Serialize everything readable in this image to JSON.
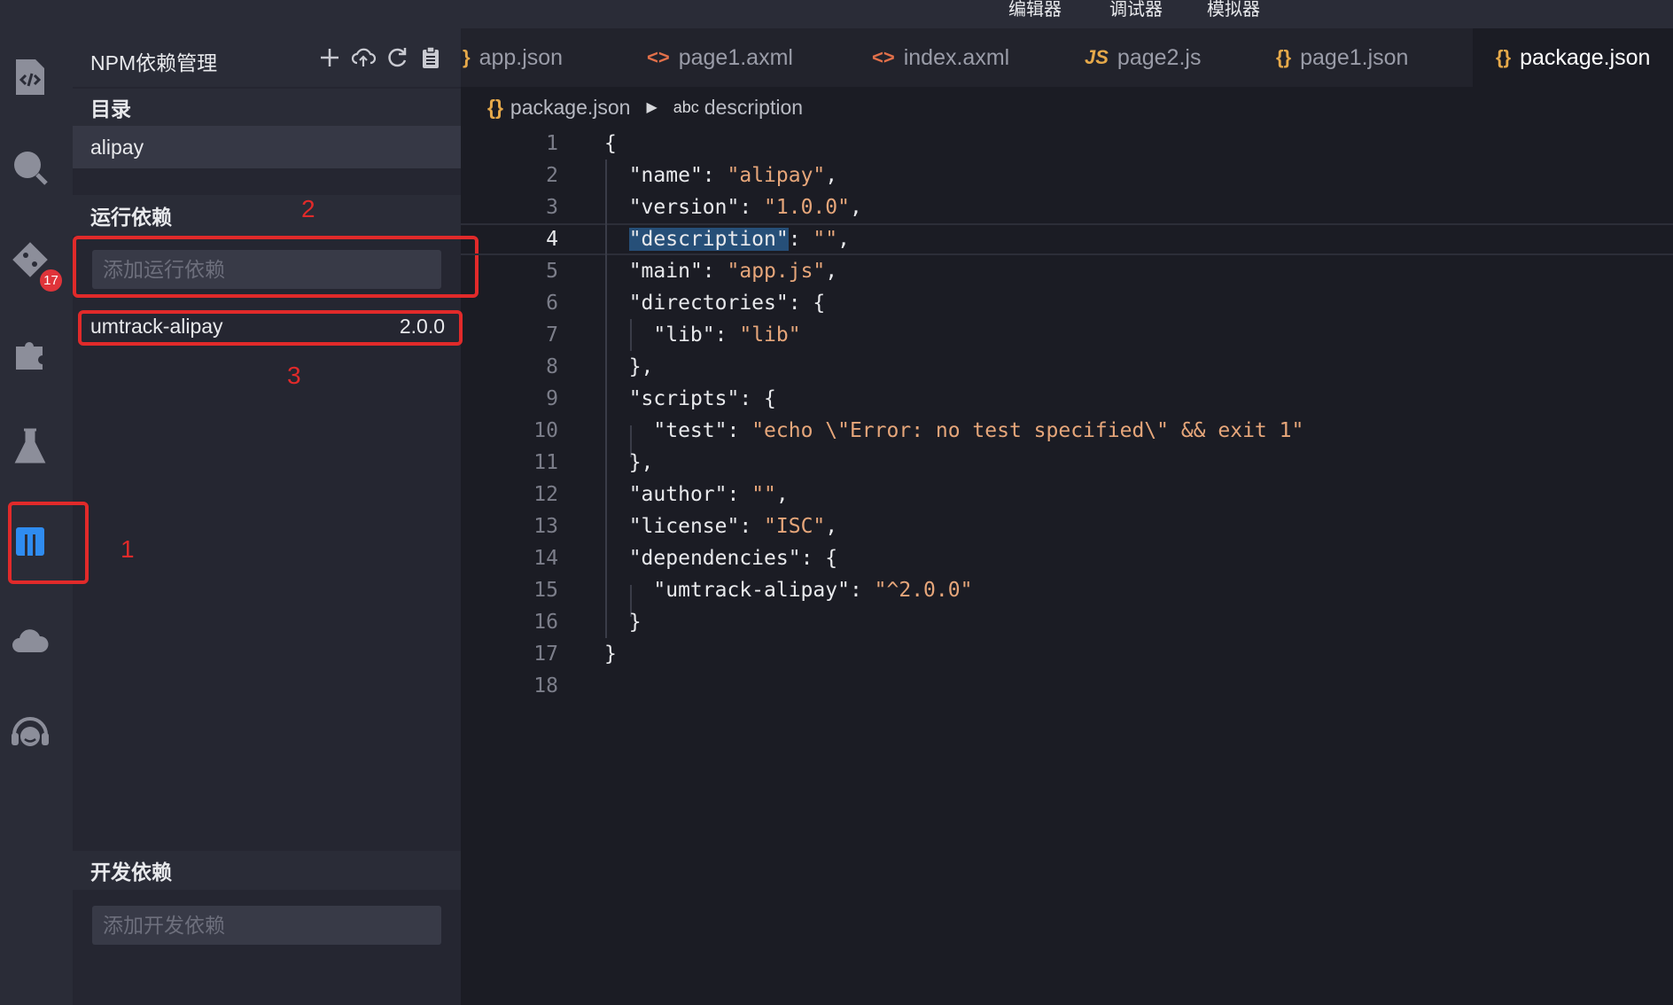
{
  "top_tabs": [
    "编辑器",
    "调试器",
    "模拟器"
  ],
  "activity": {
    "items": [
      {
        "name": "code-icon"
      },
      {
        "name": "search-icon"
      },
      {
        "name": "git-icon",
        "badge": "17"
      },
      {
        "name": "plugin-icon"
      },
      {
        "name": "flask-icon"
      },
      {
        "name": "npm-icon"
      },
      {
        "name": "cloud-icon"
      },
      {
        "name": "support-icon"
      }
    ]
  },
  "panel": {
    "title": "NPM依赖管理",
    "actions": [
      "add-icon",
      "cloud-upload-icon",
      "refresh-icon",
      "clipboard-icon"
    ],
    "directory_label": "目录",
    "directory_item": "alipay",
    "runtime_label": "运行依赖",
    "runtime_placeholder": "添加运行依赖",
    "runtime_deps": [
      {
        "name": "umtrack-alipay",
        "version": "2.0.0"
      }
    ],
    "dev_label": "开发依赖",
    "dev_placeholder": "添加开发依赖"
  },
  "annotations": [
    "1",
    "2",
    "3"
  ],
  "tabs": [
    {
      "icon": "}",
      "label": "app.json"
    },
    {
      "icon": "<>",
      "label": "page1.axml"
    },
    {
      "icon": "<>",
      "label": "index.axml"
    },
    {
      "icon": "JS",
      "label": "page2.js"
    },
    {
      "icon": "{}",
      "label": "page1.json"
    },
    {
      "icon": "{}",
      "label": "package.json",
      "active": true
    }
  ],
  "breadcrumb": {
    "icon": "{}",
    "file": "package.json",
    "symbol_kind": "abc",
    "symbol": "description"
  },
  "editor": {
    "current_line": 4,
    "line_numbers": [
      "1",
      "2",
      "3",
      "4",
      "5",
      "6",
      "7",
      "8",
      "9",
      "10",
      "11",
      "12",
      "13",
      "14",
      "15",
      "16",
      "17",
      "18"
    ]
  },
  "colors": {
    "string": "#e6a67a",
    "annotation": "#e12a2a",
    "selection": "#264f78",
    "json_icon": "#e6a94a",
    "xml_icon": "#e2704a"
  }
}
